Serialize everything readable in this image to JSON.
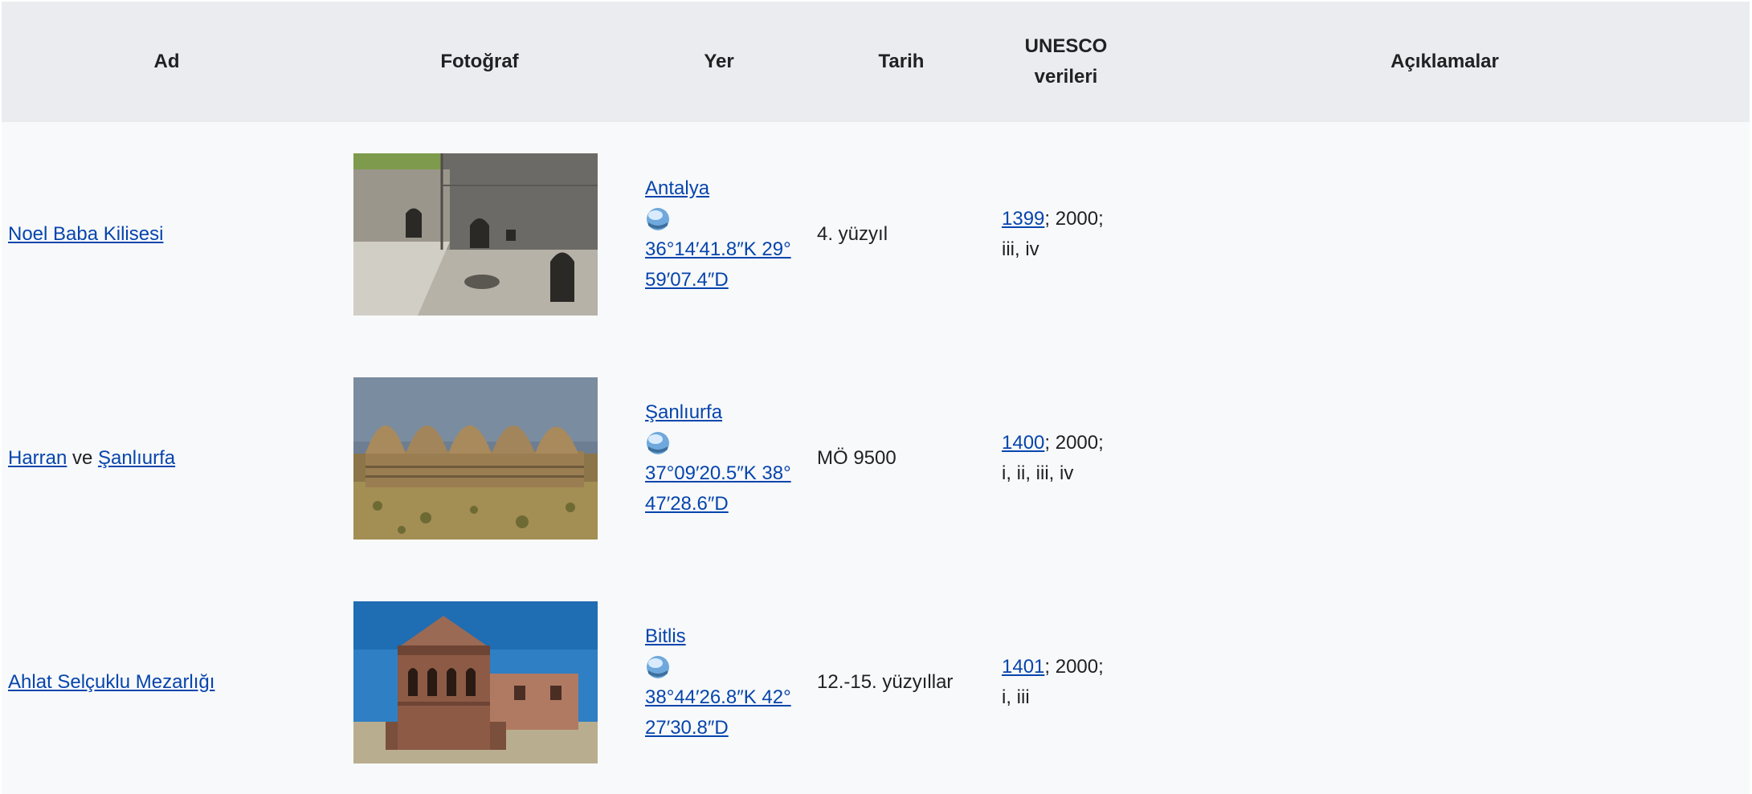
{
  "headers": {
    "ad": "Ad",
    "fotograf": "Fotoğraf",
    "yer": "Yer",
    "tarih": "Tarih",
    "unesco_line1": "UNESCO",
    "unesco_line2": "verileri",
    "aciklamalar": "Açıklamalar"
  },
  "rows": [
    {
      "name_link": "Noel Baba Kilisesi",
      "location_link": "Antalya",
      "coord_line1": "36°14′41.8″K 29°",
      "coord_line2": "59′07.4″D",
      "date": "4. yüzyıl",
      "unesco_id": "1399",
      "unesco_year": "; 2000;",
      "unesco_criteria": "iii, iv"
    },
    {
      "name_link": "Harran",
      "name_conj": " ve ",
      "name_link2": "Şanlıurfa",
      "location_link": "Şanlıurfa",
      "coord_line1": "37°09′20.5″K 38°",
      "coord_line2": "47′28.6″D",
      "date": "MÖ 9500",
      "unesco_id": "1400",
      "unesco_year": "; 2000;",
      "unesco_criteria": "i, ii, iii, iv"
    },
    {
      "name_link": "Ahlat Selçuklu Mezarlığı",
      "location_link": "Bitlis",
      "coord_line1": "38°44′26.8″K 42°",
      "coord_line2": "27′30.8″D",
      "date": "12.-15. yüzyıllar",
      "unesco_id": "1401",
      "unesco_year": "; 2000;",
      "unesco_criteria": "i, iii"
    }
  ],
  "icons": {
    "globe": "globe-icon"
  },
  "colors": {
    "header_bg": "#eaecf0",
    "row_bg": "#f8f9fa",
    "link": "#0645ad",
    "text": "#202122"
  }
}
